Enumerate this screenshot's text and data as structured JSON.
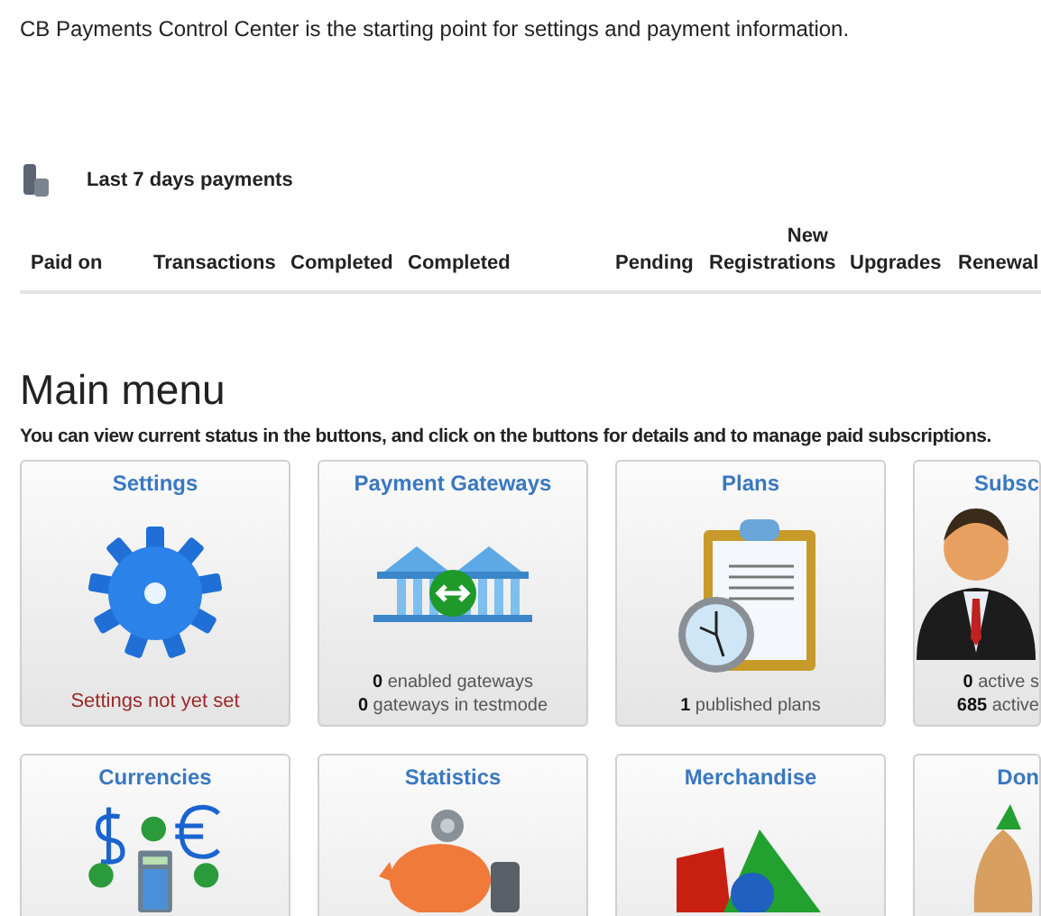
{
  "intro": "CB Payments Control Center is the starting point for settings and payment information.",
  "payments": {
    "title": "Last 7 days payments",
    "columns": [
      {
        "label": "Paid on"
      },
      {
        "label": "Transactions"
      },
      {
        "label": "Completed"
      },
      {
        "label": "Completed"
      },
      {
        "label": "Pending"
      },
      {
        "label": "New Registrations"
      },
      {
        "label": "Upgrades"
      },
      {
        "label": "Renewal"
      }
    ]
  },
  "main_menu": {
    "title": "Main menu",
    "description": "You can view current status in the buttons, and click on the buttons for details and to manage paid subscriptions.",
    "cards": [
      {
        "title": "Settings",
        "lines": [
          {
            "kind": "warning",
            "text": "Settings not yet set"
          }
        ]
      },
      {
        "title": "Payment Gateways",
        "lines": [
          {
            "kind": "stat",
            "text": "**0** enabled gateways"
          },
          {
            "kind": "stat",
            "text": "**0** gateways in testmode"
          }
        ]
      },
      {
        "title": "Plans",
        "lines": [
          {
            "kind": "stat",
            "text": "**1** published plans"
          }
        ]
      },
      {
        "title": "Subsc",
        "lines": [
          {
            "kind": "stat",
            "text": "**0** active s"
          },
          {
            "kind": "stat",
            "text": "**685** active"
          }
        ]
      },
      {
        "title": "Currencies"
      },
      {
        "title": "Statistics"
      },
      {
        "title": "Merchandise"
      },
      {
        "title": "Don"
      }
    ]
  }
}
